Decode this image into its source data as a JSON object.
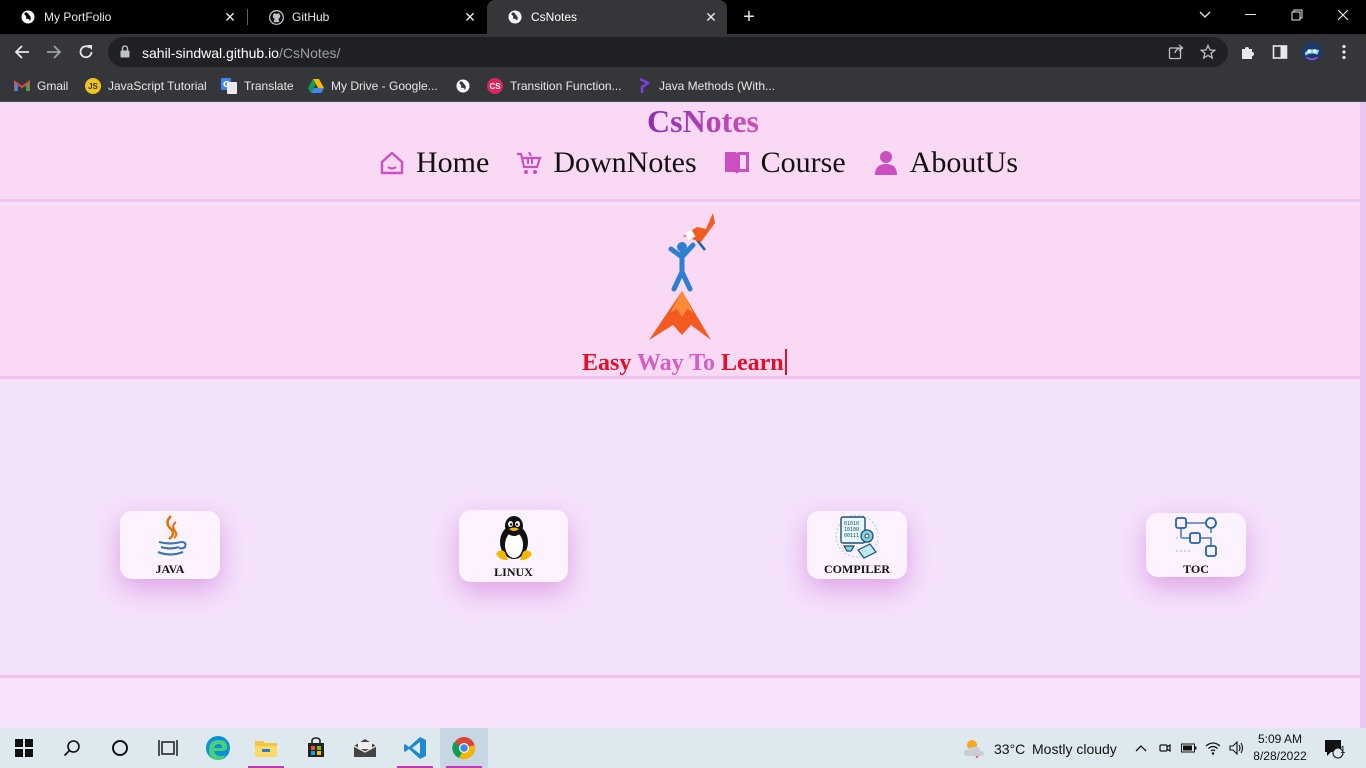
{
  "browser": {
    "tabs": [
      {
        "title": "My PortFolio",
        "active": false
      },
      {
        "title": "GitHub",
        "active": false
      },
      {
        "title": "CsNotes",
        "active": true
      }
    ],
    "url_host": "sahil-sindwal.github.io",
    "url_path": "/CsNotes/",
    "bookmarks": [
      {
        "label": "Gmail",
        "icon": "gmail-icon"
      },
      {
        "label": "JavaScript Tutorial",
        "icon": "js-icon",
        "icon_text": "JS"
      },
      {
        "label": "Translate",
        "icon": "translate-icon"
      },
      {
        "label": "My Drive - Google...",
        "icon": "drive-icon"
      },
      {
        "label": "",
        "icon": "globe-icon"
      },
      {
        "label": "Transition Function...",
        "icon": "cs-icon",
        "icon_text": "CS"
      },
      {
        "label": "Java Methods (With...",
        "icon": "programiz-icon"
      }
    ]
  },
  "site": {
    "brand": "CsNotes",
    "nav": [
      {
        "label": "Home",
        "icon": "home-icon"
      },
      {
        "label": "DownNotes",
        "icon": "cart-icon"
      },
      {
        "label": "Course",
        "icon": "book-icon"
      },
      {
        "label": "AboutUs",
        "icon": "user-icon"
      }
    ],
    "tagline": {
      "part1": "Easy",
      "part2": "Way To",
      "part3": "Learn"
    },
    "cards": [
      {
        "label": "JAVA",
        "icon": "java-icon"
      },
      {
        "label": "LINUX",
        "icon": "linux-icon"
      },
      {
        "label": "COMPILER",
        "icon": "compiler-icon"
      },
      {
        "label": "TOC",
        "icon": "toc-icon"
      }
    ]
  },
  "taskbar": {
    "weather_temp": "33°C",
    "weather_text": "Mostly cloudy",
    "time": "5:09 AM",
    "date": "8/28/2022",
    "notification_count": "1"
  },
  "colors": {
    "accent_purple": "#8a2fb4",
    "accent_pink": "#d24fb6",
    "tagline_red": "#e0102a",
    "page_bg": "#fad9f5"
  }
}
